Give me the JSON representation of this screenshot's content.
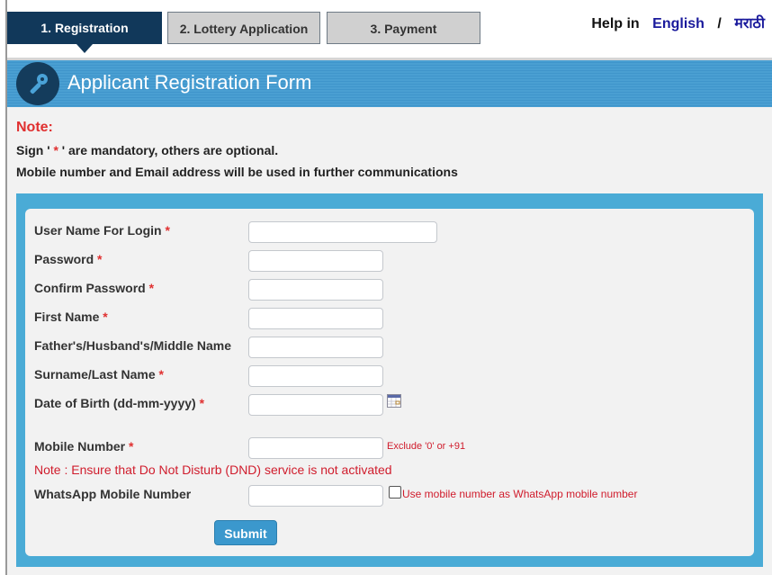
{
  "tabs": [
    {
      "label": "1. Registration",
      "active": true
    },
    {
      "label": "2. Lottery Application",
      "active": false
    },
    {
      "label": "3. Payment",
      "active": false
    }
  ],
  "help": {
    "label": "Help in",
    "english": "English",
    "separator": "/",
    "marathi": "मराठी"
  },
  "header": {
    "title": "Applicant Registration Form",
    "icon": "key-icon"
  },
  "notes": {
    "title": "Note:",
    "line1_prefix": "Sign '",
    "line1_star": " * ",
    "line1_suffix": "' are mandatory, others are optional.",
    "line2": "Mobile number and Email address will be used in further communications"
  },
  "form": {
    "fields": [
      {
        "label": "User Name For Login",
        "required": "*",
        "value": ""
      },
      {
        "label": "Password",
        "required": "*",
        "value": ""
      },
      {
        "label": "Confirm Password",
        "required": "*",
        "value": ""
      },
      {
        "label": "First Name",
        "required": "*",
        "value": ""
      },
      {
        "label": "Father's/Husband's/Middle Name",
        "required": "",
        "value": ""
      },
      {
        "label": "Surname/Last Name",
        "required": "*",
        "value": ""
      },
      {
        "label": "Date of Birth (dd-mm-yyyy)",
        "required": "*",
        "value": ""
      },
      {
        "label": "Mobile Number",
        "required": "*",
        "value": ""
      },
      {
        "label": "WhatsApp Mobile Number",
        "required": "",
        "value": ""
      }
    ],
    "mobile_hint": "Exclude '0' or +91",
    "dnd_note": "Note : Ensure that Do Not Disturb (DND) service is not activated",
    "whatsapp_checkbox_label": "Use mobile number as WhatsApp mobile number",
    "whatsapp_checkbox_checked": false,
    "submit_label": "Submit"
  },
  "colors": {
    "accent": "#11385a",
    "header_blue": "#4a9fd2",
    "error_red": "#d01c2c",
    "button_blue": "#3b98cd"
  }
}
